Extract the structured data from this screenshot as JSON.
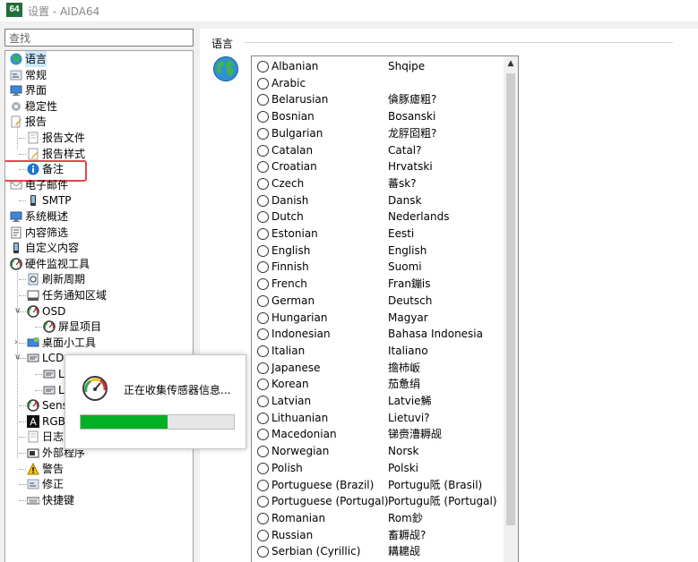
{
  "window": {
    "app_icon_text": "64",
    "title": "设置 - AIDA64"
  },
  "search": {
    "placeholder": "查找"
  },
  "tree": [
    {
      "label": "语言",
      "icon": "globe-icon",
      "indent": 0,
      "selected": true
    },
    {
      "label": "常规",
      "icon": "settings-icon",
      "indent": 0
    },
    {
      "label": "界面",
      "icon": "monitor-icon",
      "indent": 0
    },
    {
      "label": "稳定性",
      "icon": "gear-icon",
      "indent": 0
    },
    {
      "label": "报告",
      "icon": "report-icon",
      "indent": 0
    },
    {
      "label": "报告文件",
      "icon": "document-icon",
      "indent": 1
    },
    {
      "label": "报告样式",
      "icon": "edit-document-icon",
      "indent": 1
    },
    {
      "label": "备注",
      "icon": "info-icon",
      "indent": 1
    },
    {
      "label": "电子邮件",
      "icon": "email-icon",
      "indent": 0
    },
    {
      "label": "SMTP",
      "icon": "phone-icon",
      "indent": 1
    },
    {
      "label": "系统概述",
      "icon": "monitor-icon",
      "indent": 0
    },
    {
      "label": "内容筛选",
      "icon": "filter-icon",
      "indent": 0
    },
    {
      "label": "自定义内容",
      "icon": "phone-icon",
      "indent": 0
    },
    {
      "label": "硬件监视工具",
      "icon": "gauge-icon",
      "indent": 0
    },
    {
      "label": "刷新周期",
      "icon": "clock-icon",
      "indent": 1
    },
    {
      "label": "任务通知区域",
      "icon": "taskbar-icon",
      "indent": 1
    },
    {
      "label": "OSD",
      "icon": "gauge-icon",
      "indent": 1,
      "expander": "v"
    },
    {
      "label": "屏显项目",
      "icon": "gauge-icon",
      "indent": 2
    },
    {
      "label": "桌面小工具",
      "icon": "desktop-gadget-icon",
      "indent": 1,
      "expander": ">"
    },
    {
      "label": "LCD",
      "icon": "lcd-icon",
      "indent": 1,
      "expander": "v"
    },
    {
      "label": "L",
      "icon": "lcd-icon",
      "indent": 2
    },
    {
      "label": "L",
      "icon": "lcd-icon",
      "indent": 2
    },
    {
      "label": "Sens",
      "icon": "gauge-icon",
      "indent": 1
    },
    {
      "label": "RGB",
      "icon": "rgb-icon",
      "indent": 1
    },
    {
      "label": "日志",
      "icon": "document-icon",
      "indent": 1
    },
    {
      "label": "外部程序",
      "icon": "camera-icon",
      "indent": 1
    },
    {
      "label": "警告",
      "icon": "warning-icon",
      "indent": 1
    },
    {
      "label": "修正",
      "icon": "settings-icon",
      "indent": 1
    },
    {
      "label": "快捷键",
      "icon": "keyboard-icon",
      "indent": 1
    }
  ],
  "content": {
    "group_title": "语言"
  },
  "languages": [
    {
      "name": "Albanian",
      "native": "Shqipe"
    },
    {
      "name": "Arabic",
      "native": ""
    },
    {
      "name": "Belarusian",
      "native": "僋豚瘧粗?"
    },
    {
      "name": "Bosnian",
      "native": "Bosanski"
    },
    {
      "name": "Bulgarian",
      "native": "龙脬囵粗?"
    },
    {
      "name": "Catalan",
      "native": "Catal?"
    },
    {
      "name": "Croatian",
      "native": "Hrvatski"
    },
    {
      "name": "Czech",
      "native": "蕃sk?"
    },
    {
      "name": "Danish",
      "native": "Dansk"
    },
    {
      "name": "Dutch",
      "native": "Nederlands"
    },
    {
      "name": "Estonian",
      "native": "Eesti"
    },
    {
      "name": "English",
      "native": "English"
    },
    {
      "name": "Finnish",
      "native": "Suomi"
    },
    {
      "name": "French",
      "native": "Fran鏰is"
    },
    {
      "name": "German",
      "native": "Deutsch"
    },
    {
      "name": "Hungarian",
      "native": "Magyar"
    },
    {
      "name": "Indonesian",
      "native": "Bahasa Indonesia"
    },
    {
      "name": "Italian",
      "native": "Italiano"
    },
    {
      "name": "Japanese",
      "native": "擔杮岅"
    },
    {
      "name": "Korean",
      "native": "茄惫绢"
    },
    {
      "name": "Latvian",
      "native": "Latvie鯑"
    },
    {
      "name": "Lithuanian",
      "native": "Lietuvi?"
    },
    {
      "name": "Macedonian",
      "native": "锑赍漕耨觇"
    },
    {
      "name": "Norwegian",
      "native": "Norsk"
    },
    {
      "name": "Polish",
      "native": "Polski"
    },
    {
      "name": "Portuguese (Brazil)",
      "native": "Portugu阺 (Brasil)"
    },
    {
      "name": "Portuguese (Portugal)",
      "native": "Portugu阺 (Portugal)"
    },
    {
      "name": "Romanian",
      "native": "Rom鈔"
    },
    {
      "name": "Russian",
      "native": "畜耨觇?"
    },
    {
      "name": "Serbian (Cyrillic)",
      "native": "耩耱觇"
    }
  ],
  "popup": {
    "message": "正在收集传感器信息...",
    "progress_fraction": 0.57
  },
  "colors": {
    "progress": "#06b025",
    "highlight": "#e8454a",
    "selection": "#cce8ff"
  }
}
